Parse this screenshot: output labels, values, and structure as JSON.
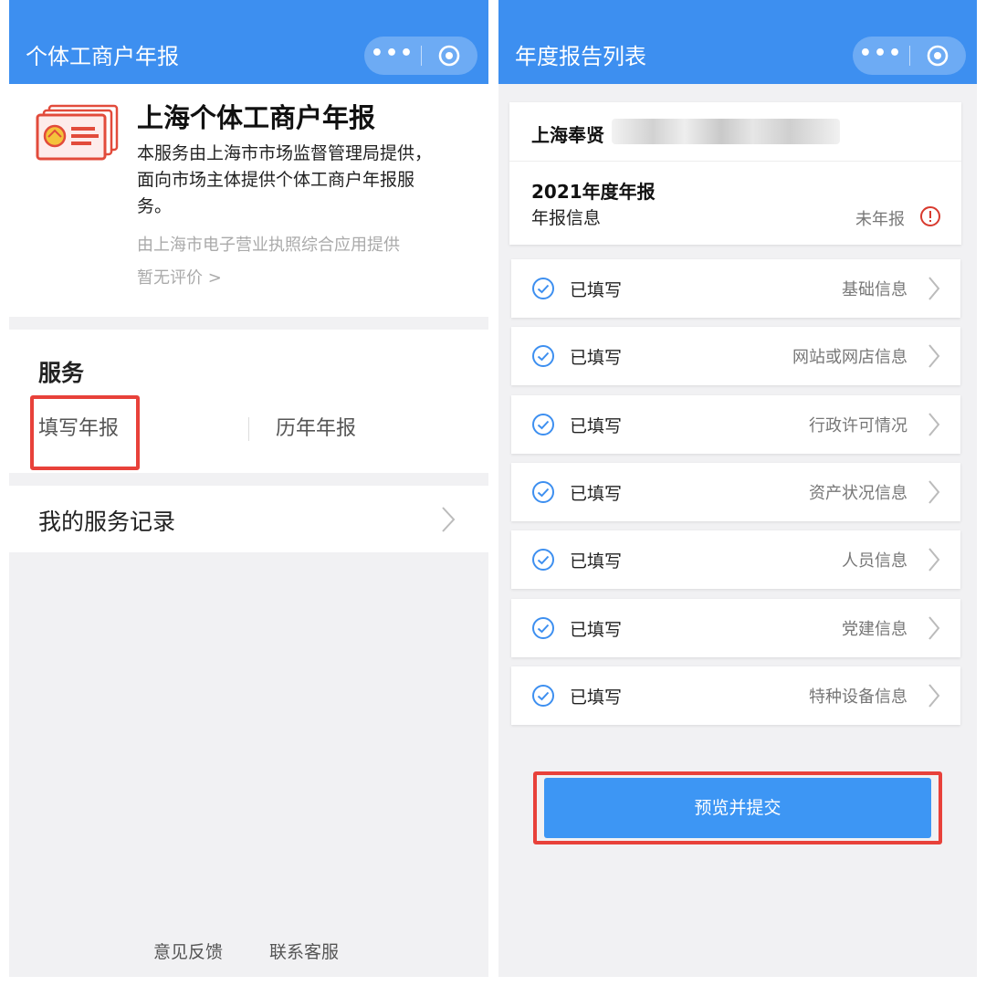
{
  "left": {
    "nav_title": "个体工商户年报",
    "info": {
      "title": "上海个体工商户年报",
      "description": "本服务由上海市市场监督管理局提供，面向市场主体提供个体工商户年报服务。",
      "provider": "由上海市电子营业执照综合应用提供",
      "rating": "暂无评价 >"
    },
    "services": {
      "heading": "服务",
      "fill_report": "填写年报",
      "history_report": "历年年报"
    },
    "service_record": "我的服务记录",
    "footer": {
      "feedback": "意见反馈",
      "contact": "联系客服"
    }
  },
  "right": {
    "nav_title": "年度报告列表",
    "company": {
      "name_prefix": "上海奉贤",
      "year_title": "2021年度年报",
      "report_label": "年报信息",
      "report_status": "未年报"
    },
    "sections": [
      {
        "status": "已填写",
        "name": "基础信息"
      },
      {
        "status": "已填写",
        "name": "网站或网店信息"
      },
      {
        "status": "已填写",
        "name": "行政许可情况"
      },
      {
        "status": "已填写",
        "name": "资产状况信息"
      },
      {
        "status": "已填写",
        "name": "人员信息"
      },
      {
        "status": "已填写",
        "name": "党建信息"
      },
      {
        "status": "已填写",
        "name": "特种设备信息"
      }
    ],
    "submit_label": "预览并提交"
  },
  "colors": {
    "nav_blue": "#3d8ff0",
    "button_blue": "#3d96f4",
    "highlight_red": "#e8413a",
    "warning_red": "#d83a2e"
  },
  "icons": {
    "more": "more-dots-icon",
    "close": "target-close-icon",
    "service": "id-card-icon",
    "check": "check-circle-icon",
    "warning": "exclamation-circle-icon",
    "chevron": "chevron-right-icon"
  }
}
